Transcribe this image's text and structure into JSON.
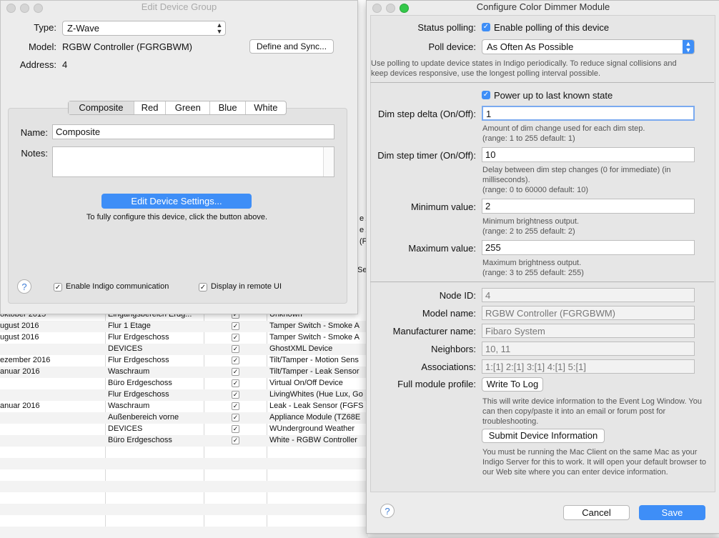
{
  "background_table": {
    "rows": [
      {
        "col1": "oktober 2015",
        "col2": "Eingangsbereich Erdg...",
        "col3": "Unknown"
      },
      {
        "col1": "ugust 2016",
        "col2": "Flur 1 Etage",
        "col3": "Tamper Switch - Smoke A"
      },
      {
        "col1": "ugust 2016",
        "col2": "Flur Erdgeschoss",
        "col3": "Tamper Switch - Smoke A"
      },
      {
        "col1": "",
        "col2": "DEVICES",
        "col3": "GhostXML Device"
      },
      {
        "col1": "ezember 2016",
        "col2": "Flur Erdgeschoss",
        "col3": "Tilt/Tamper - Motion Sens"
      },
      {
        "col1": "anuar 2016",
        "col2": "Waschraum",
        "col3": "Tilt/Tamper - Leak Sensor"
      },
      {
        "col1": "",
        "col2": "Büro Erdgeschoss",
        "col3": "Virtual On/Off Device"
      },
      {
        "col1": "",
        "col2": "Flur Erdgeschoss",
        "col3": "LivingWhites (Hue Lux, Go"
      },
      {
        "col1": "anuar 2016",
        "col2": "Waschraum",
        "col3": "Leak - Leak Sensor (FGFS"
      },
      {
        "col1": "",
        "col2": "Außenbereich vorne",
        "col3": "Appliance Module (TZ68E"
      },
      {
        "col1": "",
        "col2": "DEVICES",
        "col3": "WUnderground Weather"
      },
      {
        "col1": "",
        "col2": "Büro Erdgeschoss",
        "col3": "White - RGBW Controller"
      }
    ],
    "peek_texts": [
      "e A",
      "e A",
      "(F",
      "Sen"
    ]
  },
  "left_window": {
    "title": "Edit Device Group",
    "type_label": "Type:",
    "type_value": "Z-Wave",
    "model_label": "Model:",
    "model_value": "RGBW Controller (FGRGBWM)",
    "define_sync": "Define and Sync...",
    "address_label": "Address:",
    "address_value": "4",
    "tabs": [
      "Composite",
      "Red",
      "Green",
      "Blue",
      "White"
    ],
    "name_label": "Name:",
    "name_value": "Composite",
    "notes_label": "Notes:",
    "edit_settings": "Edit Device Settings...",
    "edit_hint": "To fully configure this device, click the button above.",
    "enable_comm": "Enable Indigo communication",
    "display_remote": "Display in remote UI",
    "help": "?"
  },
  "right_window": {
    "title": "Configure Color Dimmer Module",
    "status_polling_label": "Status polling:",
    "status_polling_cb": "Enable polling of this device",
    "poll_device_label": "Poll device:",
    "poll_device_value": "As Often As Possible",
    "poll_help": "Use polling to update device states in Indigo periodically. To reduce signal collisions and keep devices responsive, use the longest polling interval possible.",
    "power_up": "Power up to last known state",
    "dim_delta_label": "Dim step delta (On/Off):",
    "dim_delta_value": "1",
    "dim_delta_help1": "Amount of dim change used for each dim step.",
    "dim_delta_help2": "(range: 1 to 255   default: 1)",
    "dim_timer_label": "Dim step timer (On/Off):",
    "dim_timer_value": "10",
    "dim_timer_help1": "Delay between dim step changes (0 for immediate) (in milliseconds).",
    "dim_timer_help2": "(range: 0 to 60000   default: 10)",
    "min_label": "Minimum value:",
    "min_value": "2",
    "min_help1": "Minimum brightness output.",
    "min_help2": "(range: 2 to 255   default: 2)",
    "max_label": "Maximum value:",
    "max_value": "255",
    "max_help1": "Maximum brightness output.",
    "max_help2": "(range: 3 to 255   default: 255)",
    "node_id_label": "Node ID:",
    "node_id_value": "4",
    "model_name_label": "Model name:",
    "model_name_value": "RGBW Controller (FGRGBWM)",
    "manufacturer_label": "Manufacturer name:",
    "manufacturer_value": "Fibaro System",
    "neighbors_label": "Neighbors:",
    "neighbors_value": "10, 11",
    "associations_label": "Associations:",
    "associations_value": "1:[1] 2:[1] 3:[1] 4:[1] 5:[1]",
    "full_profile_label": "Full module profile:",
    "write_to_log": "Write To Log",
    "write_help": "This will write device information to the Event Log Window. You can then copy/paste it into an email or forum post for troubleshooting.",
    "submit_info": "Submit Device Information",
    "submit_help": "You must be running the Mac Client on the same Mac as your Indigo Server for this to work. It will open your default browser to our Web site where you can enter device information.",
    "cancel": "Cancel",
    "save": "Save",
    "help": "?"
  },
  "colors": {
    "accent": "#3e8ef7",
    "close": "#fc605c",
    "minimize": "#fdbc40",
    "zoom": "#34c84a"
  }
}
